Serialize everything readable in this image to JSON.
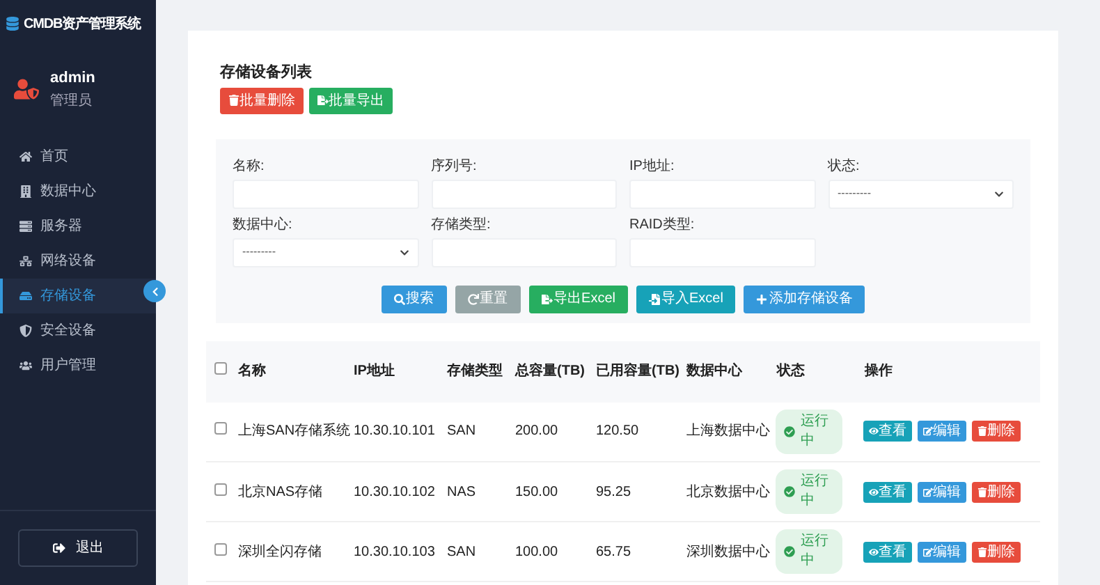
{
  "app": {
    "title": "CMDB资产管理系统"
  },
  "user": {
    "name": "admin",
    "role": "管理员"
  },
  "sidebar": {
    "items": [
      {
        "label": "首页",
        "selected": false
      },
      {
        "label": "数据中心",
        "selected": false
      },
      {
        "label": "服务器",
        "selected": false
      },
      {
        "label": "网络设备",
        "selected": false
      },
      {
        "label": "存储设备",
        "selected": true
      },
      {
        "label": "安全设备",
        "selected": false
      },
      {
        "label": "用户管理",
        "selected": false
      }
    ],
    "logout": "退出"
  },
  "page": {
    "title": "存储设备列表",
    "bulk_buttons": [
      {
        "label": "批量删除",
        "kind": "danger"
      },
      {
        "label": "批量导出",
        "kind": "success"
      }
    ]
  },
  "filters": [
    {
      "label": "名称:",
      "kind": "input"
    },
    {
      "label": "序列号:",
      "kind": "input"
    },
    {
      "label": "IP地址:",
      "kind": "input"
    },
    {
      "label": "状态:",
      "kind": "select",
      "value": "---------"
    },
    {
      "label": "数据中心:",
      "kind": "select",
      "value": "---------"
    },
    {
      "label": "存储类型:",
      "kind": "input"
    },
    {
      "label": "RAID类型:",
      "kind": "input"
    }
  ],
  "filter_buttons": [
    {
      "label": "搜索",
      "kind": "primary"
    },
    {
      "label": "重置",
      "kind": "secondary"
    },
    {
      "label": "导出Excel",
      "kind": "success"
    },
    {
      "label": "导入Excel",
      "kind": "info"
    },
    {
      "label": "添加存储设备",
      "kind": "primary"
    }
  ],
  "table": {
    "header_checked": false,
    "columns": [
      "名称",
      "IP地址",
      "存储类型",
      "总容量(TB)",
      "已用容量(TB)",
      "数据中心",
      "状态",
      "操作"
    ],
    "rows": [
      {
        "checked": false,
        "name": "上海SAN存储系统",
        "ip": "10.30.10.101",
        "type": "SAN",
        "total": "200.00",
        "used": "120.50",
        "datacenter": "上海数据中心",
        "status": "运行中",
        "actions": [
          {
            "label": "查看",
            "kind": "info"
          },
          {
            "label": "编辑",
            "kind": "primary"
          },
          {
            "label": "删除",
            "kind": "danger"
          }
        ]
      },
      {
        "checked": false,
        "name": "北京NAS存储",
        "ip": "10.30.10.102",
        "type": "NAS",
        "total": "150.00",
        "used": "95.25",
        "datacenter": "北京数据中心",
        "status": "运行中",
        "actions": [
          {
            "label": "查看",
            "kind": "info"
          },
          {
            "label": "编辑",
            "kind": "primary"
          },
          {
            "label": "删除",
            "kind": "danger"
          }
        ]
      },
      {
        "checked": false,
        "name": "深圳全闪存储",
        "ip": "10.30.10.103",
        "type": "SAN",
        "total": "100.00",
        "used": "65.75",
        "datacenter": "深圳数据中心",
        "status": "运行中",
        "actions": [
          {
            "label": "查看",
            "kind": "info"
          },
          {
            "label": "编辑",
            "kind": "primary"
          },
          {
            "label": "删除",
            "kind": "danger"
          }
        ]
      }
    ]
  }
}
